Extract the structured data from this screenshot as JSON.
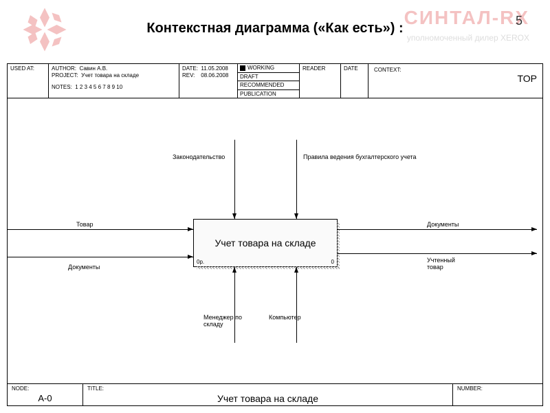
{
  "page_number": "5",
  "page_title": "Контекстная диаграмма («Как есть») :",
  "watermark": {
    "brand": "СИНТАЛ-RX",
    "tagline": "уполномоченный дилер XEROX"
  },
  "header": {
    "used_at_label": "USED AT:",
    "author_label": "AUTHOR:",
    "author": "Савин А.В.",
    "project_label": "PROJECT:",
    "project": "Учет товара на складе",
    "notes_label": "NOTES:",
    "notes": "1 2 3 4 5 6 7 8 9 10",
    "date_label": "DATE:",
    "date": "11.05.2008",
    "rev_label": "REV:",
    "rev": "08.06.2008",
    "status_working": "WORKING",
    "status_draft": "DRAFT",
    "status_recommended": "RECOMMENDED",
    "status_publication": "PUBLICATION",
    "reader_label": "READER",
    "reader_date_label": "DATE",
    "context_label": "CONTEXT:",
    "context_value": "TOP"
  },
  "diagram": {
    "process_name": "Учет товара на складе",
    "process_corner_left": "0р.",
    "process_corner_right": "0",
    "inputs": [
      "Товар",
      "Документы"
    ],
    "controls": [
      "Законодательство",
      "Правила ведения бухгалтерского учета"
    ],
    "outputs": [
      "Документы",
      "Учтенный товар"
    ],
    "mechanisms": [
      "Менеджер по складу",
      "Компьютер"
    ]
  },
  "footer": {
    "node_label": "NODE:",
    "node_value": "A-0",
    "title_label": "TITLE:",
    "title_value": "Учет товара на складе",
    "number_label": "NUMBER:"
  }
}
